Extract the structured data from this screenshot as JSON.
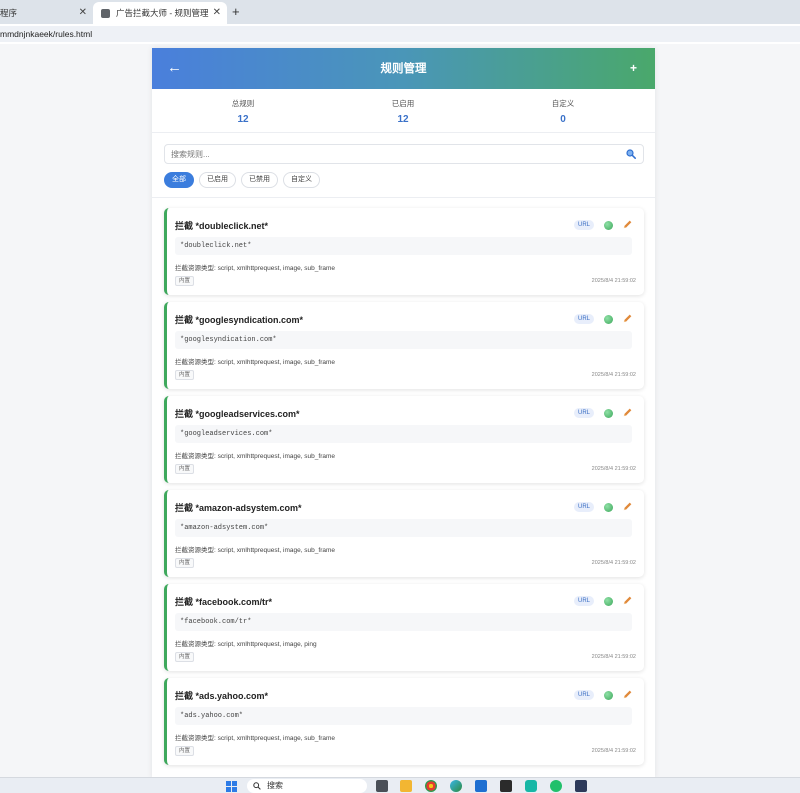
{
  "browser": {
    "tabs": [
      {
        "label": "程序"
      },
      {
        "label": "广告拦截大师 - 规则管理"
      }
    ],
    "new_tab": "+",
    "close_glyph": "✕",
    "address": "mmdnjnkaeek/rules.html"
  },
  "header": {
    "back": "←",
    "title": "规则管理",
    "add": "+"
  },
  "stats": [
    {
      "label": "总规则",
      "value": "12"
    },
    {
      "label": "已启用",
      "value": "12"
    },
    {
      "label": "自定义",
      "value": "0"
    }
  ],
  "search": {
    "placeholder": "搜索规则..."
  },
  "filters": [
    {
      "label": "全部",
      "active": true
    },
    {
      "label": "已启用",
      "active": false
    },
    {
      "label": "已禁用",
      "active": false
    },
    {
      "label": "自定义",
      "active": false
    }
  ],
  "rules": [
    {
      "name": "拦截 *doubleclick.net*",
      "type": "URL",
      "pattern": "*doubleclick.net*",
      "resources": "拦截资源类型: script, xmlhttprequest, image, sub_frame",
      "tag": "内置",
      "time": "2025/8/4 21:59:02"
    },
    {
      "name": "拦截 *googlesyndication.com*",
      "type": "URL",
      "pattern": "*googlesyndication.com*",
      "resources": "拦截资源类型: script, xmlhttprequest, image, sub_frame",
      "tag": "内置",
      "time": "2025/8/4 21:59:02"
    },
    {
      "name": "拦截 *googleadservices.com*",
      "type": "URL",
      "pattern": "*googleadservices.com*",
      "resources": "拦截资源类型: script, xmlhttprequest, image, sub_frame",
      "tag": "内置",
      "time": "2025/8/4 21:59:02"
    },
    {
      "name": "拦截 *amazon-adsystem.com*",
      "type": "URL",
      "pattern": "*amazon-adsystem.com*",
      "resources": "拦截资源类型: script, xmlhttprequest, image, sub_frame",
      "tag": "内置",
      "time": "2025/8/4 21:59:02"
    },
    {
      "name": "拦截 *facebook.com/tr*",
      "type": "URL",
      "pattern": "*facebook.com/tr*",
      "resources": "拦截资源类型: script, xmlhttprequest, image, ping",
      "tag": "内置",
      "time": "2025/8/4 21:59:02"
    },
    {
      "name": "拦截 *ads.yahoo.com*",
      "type": "URL",
      "pattern": "*ads.yahoo.com*",
      "resources": "拦截资源类型: script, xmlhttprequest, image, sub_frame",
      "tag": "内置",
      "time": "2025/8/4 21:59:02"
    }
  ],
  "taskbar": {
    "search": "搜索"
  },
  "colors": {
    "accent": "#3b7ddd",
    "enabled": "#3ea85c",
    "header_start": "#4a7fdc",
    "header_end": "#4aa86b"
  }
}
